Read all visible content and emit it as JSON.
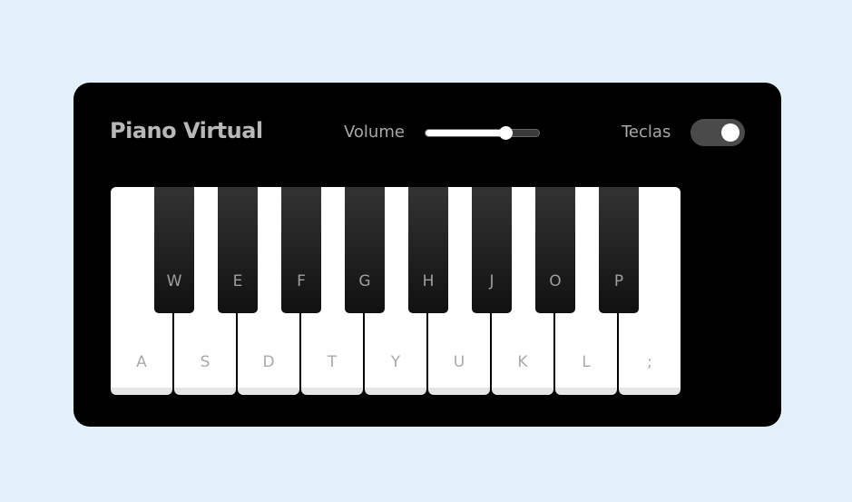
{
  "header": {
    "title": "Piano Virtual",
    "volume_label": "Volume",
    "keys_toggle_label": "Teclas"
  },
  "volume": {
    "value_fraction": 0.7
  },
  "keys_toggle": {
    "on": true
  },
  "keyboard": {
    "white_keys": [
      "A",
      "S",
      "D",
      "T",
      "Y",
      "U",
      "K",
      "L",
      ";"
    ],
    "black_keys": [
      "W",
      "E",
      "F",
      "G",
      "H",
      "J",
      "O",
      "P"
    ]
  },
  "colors": {
    "page_background": "#e3f0fc",
    "panel": "#000000",
    "title": "#b8b8b8"
  }
}
